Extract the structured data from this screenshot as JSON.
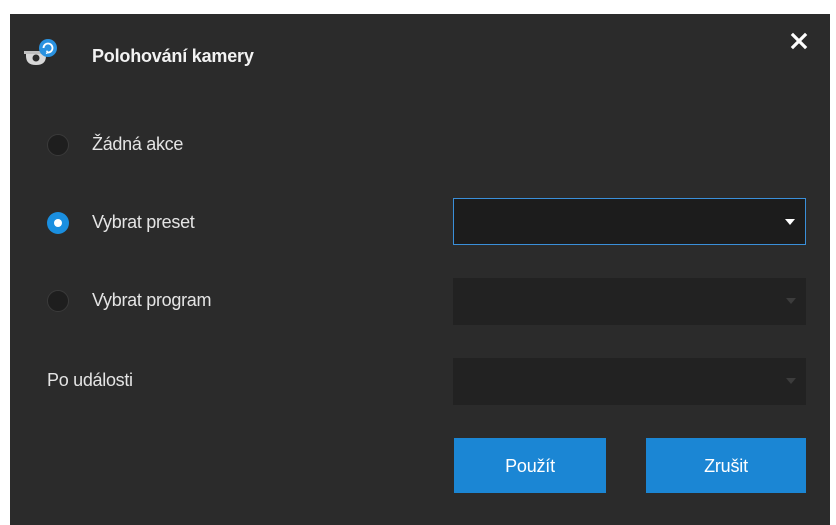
{
  "dialog": {
    "title": "Polohování kamery",
    "app_icon": "camera-positioning-icon",
    "close_icon": "close-icon"
  },
  "options": [
    {
      "label": "Žádná akce",
      "checked": false
    },
    {
      "label": "Vybrat preset",
      "checked": true
    },
    {
      "label": "Vybrat program",
      "checked": false
    }
  ],
  "event": {
    "label": "Po události"
  },
  "selects": {
    "preset": {
      "value": "",
      "state": "active"
    },
    "program": {
      "value": "",
      "state": "disabled"
    },
    "event": {
      "value": "",
      "state": "disabled"
    }
  },
  "buttons": {
    "apply_label": "Použít",
    "cancel_label": "Zrušit"
  },
  "colors": {
    "background": "#2b2b2b",
    "accent": "#1b86d4",
    "field": "#222222"
  }
}
